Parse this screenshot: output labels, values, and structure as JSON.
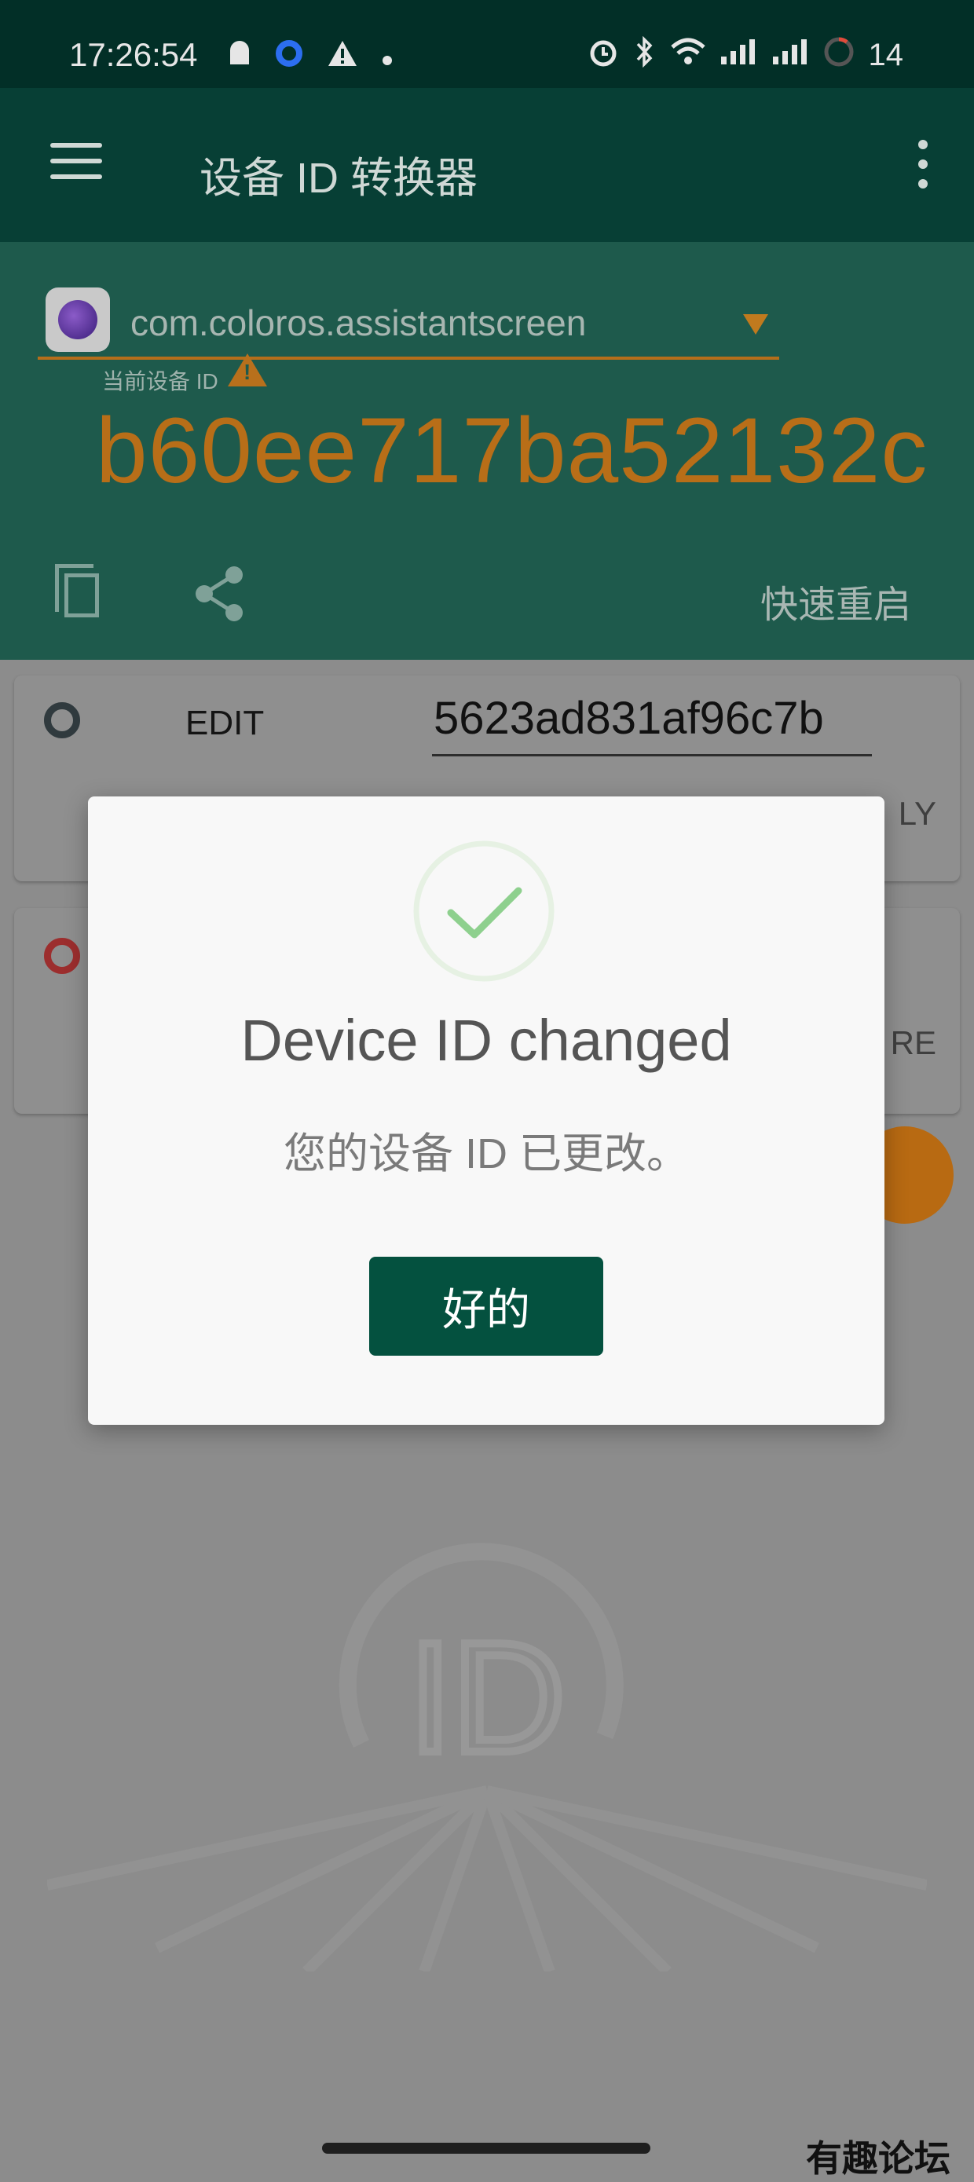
{
  "status_bar": {
    "time": "17:26:54",
    "battery": "14",
    "icons": [
      "android-icon",
      "circle-app-icon",
      "warning-icon",
      "dot-icon",
      "alarm-icon",
      "bluetooth-icon",
      "wifi-icon",
      "signal-icon",
      "signal-icon",
      "battery-icon"
    ]
  },
  "app_bar": {
    "title": "设备 ID 转换器"
  },
  "header": {
    "package_name": "com.coloros.assistantscreen",
    "current_label": "当前设备 ID",
    "current_id": "b60ee717ba52132c",
    "quick_restart": "快速重启"
  },
  "cards": [
    {
      "edit_label": "EDIT",
      "edit_value": "5623ad831af96c7b",
      "action_fragment": "LY"
    },
    {
      "action_fragment": "RE"
    }
  ],
  "dialog": {
    "title": "Device ID changed",
    "message": "您的设备 ID 已更改。",
    "ok_label": "好的"
  },
  "watermark": {
    "logo_text": "ID",
    "forum_mark": "有趣论坛"
  },
  "colors": {
    "status_bar_bg": "#022f27",
    "app_bar_bg": "#073f35",
    "panel_bg": "#1e5a4c",
    "accent_orange": "#b86e18",
    "ok_button": "#04513f",
    "check_green": "#8ed08e"
  }
}
